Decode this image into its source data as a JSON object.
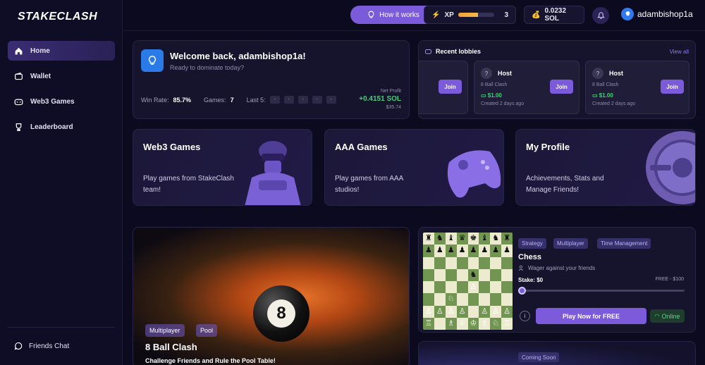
{
  "brand": "STAKECLASH",
  "sidebar": {
    "items": [
      {
        "label": "Home"
      },
      {
        "label": "Wallet"
      },
      {
        "label": "Web3 Games"
      },
      {
        "label": "Leaderboard"
      }
    ],
    "friends_chat": "Friends Chat"
  },
  "topbar": {
    "how_it_works": "How it works",
    "xp_label": "XP",
    "xp_value": "3",
    "xp_progress_pct": 55,
    "sol_balance": "0.0232 SOL",
    "username": "adambishop1a"
  },
  "welcome": {
    "title": "Welcome back, adambishop1a!",
    "subtitle": "Ready to dominate today?",
    "win_rate_label": "Win Rate:",
    "win_rate": "85.7%",
    "games_label": "Games:",
    "games": "7",
    "last5_label": "Last 5:",
    "last5": [
      "-",
      "-",
      "-",
      "-",
      "-"
    ],
    "net_profit_label": "Net Profit",
    "net_profit_sol": "+0.4151 SOL",
    "net_profit_usd": "$35.74"
  },
  "lobbies": {
    "title": "Recent lobbies",
    "view_all": "View all",
    "join_label": "Join",
    "items": [
      {
        "host": "Host",
        "game": "8 Ball Clash",
        "amount": "$1.00",
        "created": "Created 2 days ago"
      },
      {
        "host": "Host",
        "game": "8 Ball Clash",
        "amount": "$1.00",
        "created": "Created 2 days ago"
      }
    ]
  },
  "categories": [
    {
      "title": "Web3 Games",
      "desc": "Play games from StakeClash team!"
    },
    {
      "title": "AAA Games",
      "desc": "Play games from AAA studios!"
    },
    {
      "title": "My Profile",
      "desc": "Achievements, Stats and Manage Friends!"
    }
  ],
  "hero": {
    "tags": [
      "Multiplayer",
      "Pool"
    ],
    "title": "8 Ball Clash",
    "subtitle": "Challenge Friends and Rule the Pool Table!",
    "ball_number": "8"
  },
  "chess": {
    "tags": [
      "Strategy",
      "Multiplayer",
      "Time Management"
    ],
    "title": "Chess",
    "wager": "Wager against your friends",
    "stake": "Stake: $0",
    "range": "FREE - $100",
    "play": "Play Now for FREE",
    "online": "Online",
    "info": "i"
  },
  "coming_soon": "Coming Soon"
}
